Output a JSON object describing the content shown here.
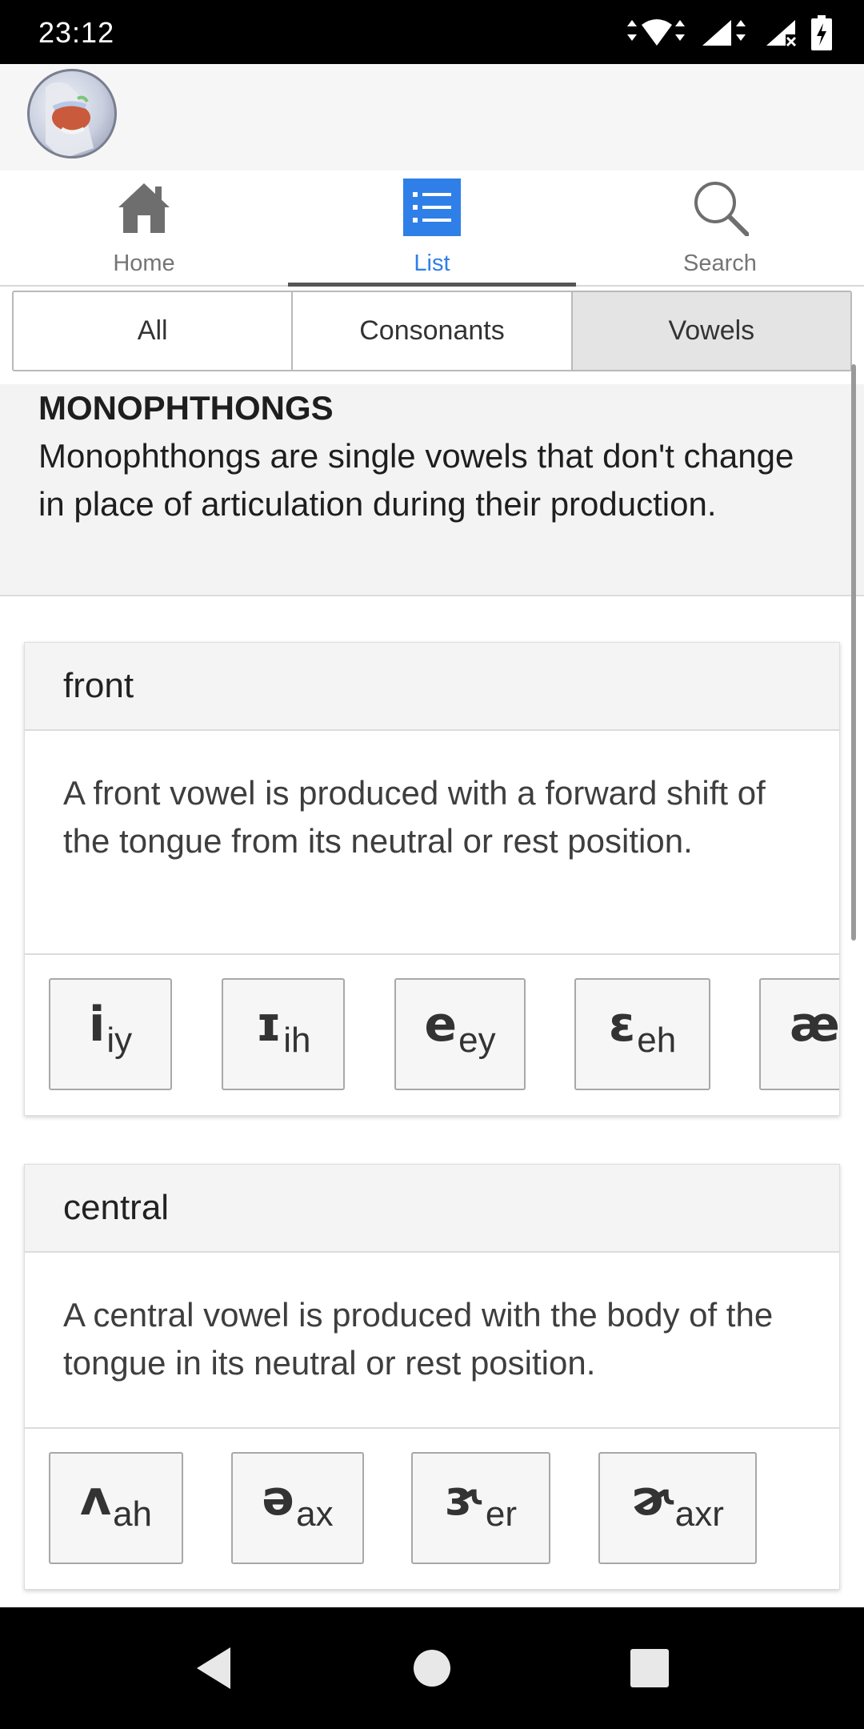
{
  "status_bar": {
    "time": "23:12"
  },
  "nav": {
    "tabs": [
      {
        "label": "Home",
        "icon": "home-icon"
      },
      {
        "label": "List",
        "icon": "list-icon",
        "active": true
      },
      {
        "label": "Search",
        "icon": "search-icon"
      }
    ]
  },
  "filter": {
    "options": [
      "All",
      "Consonants",
      "Vowels"
    ],
    "selected": "Vowels"
  },
  "section": {
    "title": "MONOPHTHONGS",
    "description": "Monophthongs are single vowels that don't change in place of articulation during their production."
  },
  "cards": [
    {
      "title": "front",
      "description": "A front vowel is produced with a forward shift of the tongue from its neutral or rest position.",
      "sounds": [
        {
          "symbol": "i",
          "code": "iy"
        },
        {
          "symbol": "ɪ",
          "code": "ih"
        },
        {
          "symbol": "e",
          "code": "ey"
        },
        {
          "symbol": "ɛ",
          "code": "eh"
        },
        {
          "symbol": "æ",
          "code": ""
        }
      ]
    },
    {
      "title": "central",
      "description": "A central vowel is produced with the body of the tongue in its neutral or rest position.",
      "sounds": [
        {
          "symbol": "ʌ",
          "code": "ah"
        },
        {
          "symbol": "ə",
          "code": "ax"
        },
        {
          "symbol": "ɝ",
          "code": "er"
        },
        {
          "symbol": "ɚ",
          "code": "axr"
        }
      ]
    }
  ],
  "colors": {
    "accent": "#2f7fe8",
    "nav_indicator": "#555555"
  }
}
